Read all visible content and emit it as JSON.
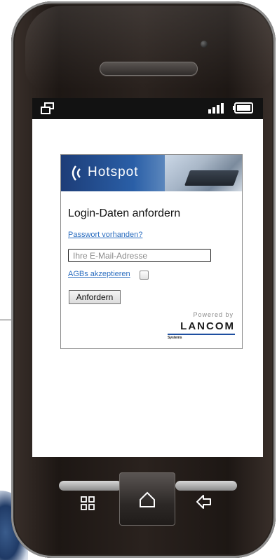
{
  "hotspot": {
    "brand": "Hotspot"
  },
  "form": {
    "title": "Login-Daten anfordern",
    "password_link": "Passwort vorhanden?",
    "email_placeholder": "Ihre E-Mail-Adresse",
    "agb_link": "AGBs akzeptieren",
    "agb_checked": false,
    "submit_label": "Anfordern"
  },
  "footer": {
    "powered_by": "Powered by",
    "lancom": "LANCOM",
    "systems": "Systems"
  },
  "icons": {
    "status_left": "window-icon",
    "status_signal": "signal-icon",
    "status_battery": "battery-icon",
    "nav_menu": "menu-icon",
    "nav_home": "home-icon",
    "nav_back": "back-icon",
    "banner": "wifi-icon"
  },
  "colors": {
    "link": "#2a6dc0",
    "banner_blue": "#1d3d78",
    "lancom_blue": "#1e4fa0"
  }
}
